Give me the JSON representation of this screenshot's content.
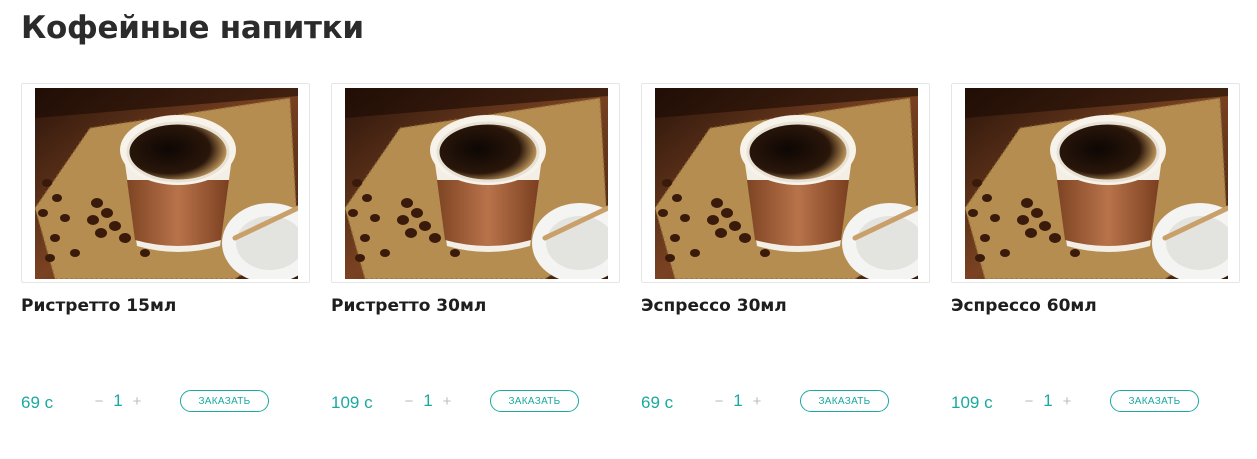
{
  "section": {
    "title": "Кофейные напитки"
  },
  "products": [
    {
      "name": "Ристретто 15мл",
      "price": "69 с",
      "quantity": "1",
      "order_label": "ЗАКАЗАТЬ",
      "minus": "−",
      "plus": "+"
    },
    {
      "name": "Ристретто 30мл",
      "price": "109 с",
      "quantity": "1",
      "order_label": "ЗАКАЗАТЬ",
      "minus": "−",
      "plus": "+"
    },
    {
      "name": "Эспрессо 30мл",
      "price": "69 с",
      "quantity": "1",
      "order_label": "ЗАКАЗАТЬ",
      "minus": "−",
      "plus": "+"
    },
    {
      "name": "Эспрессо 60мл",
      "price": "109 с",
      "quantity": "1",
      "order_label": "ЗАКАЗАТЬ",
      "minus": "−",
      "plus": "+"
    }
  ],
  "colors": {
    "accent": "#1aa9a0",
    "title": "#2b2b2b",
    "wood": "#6b3a1c",
    "burlap": "#b8904f",
    "cup_sleeve": "#a8643a",
    "coffee": "#1a0f08"
  }
}
